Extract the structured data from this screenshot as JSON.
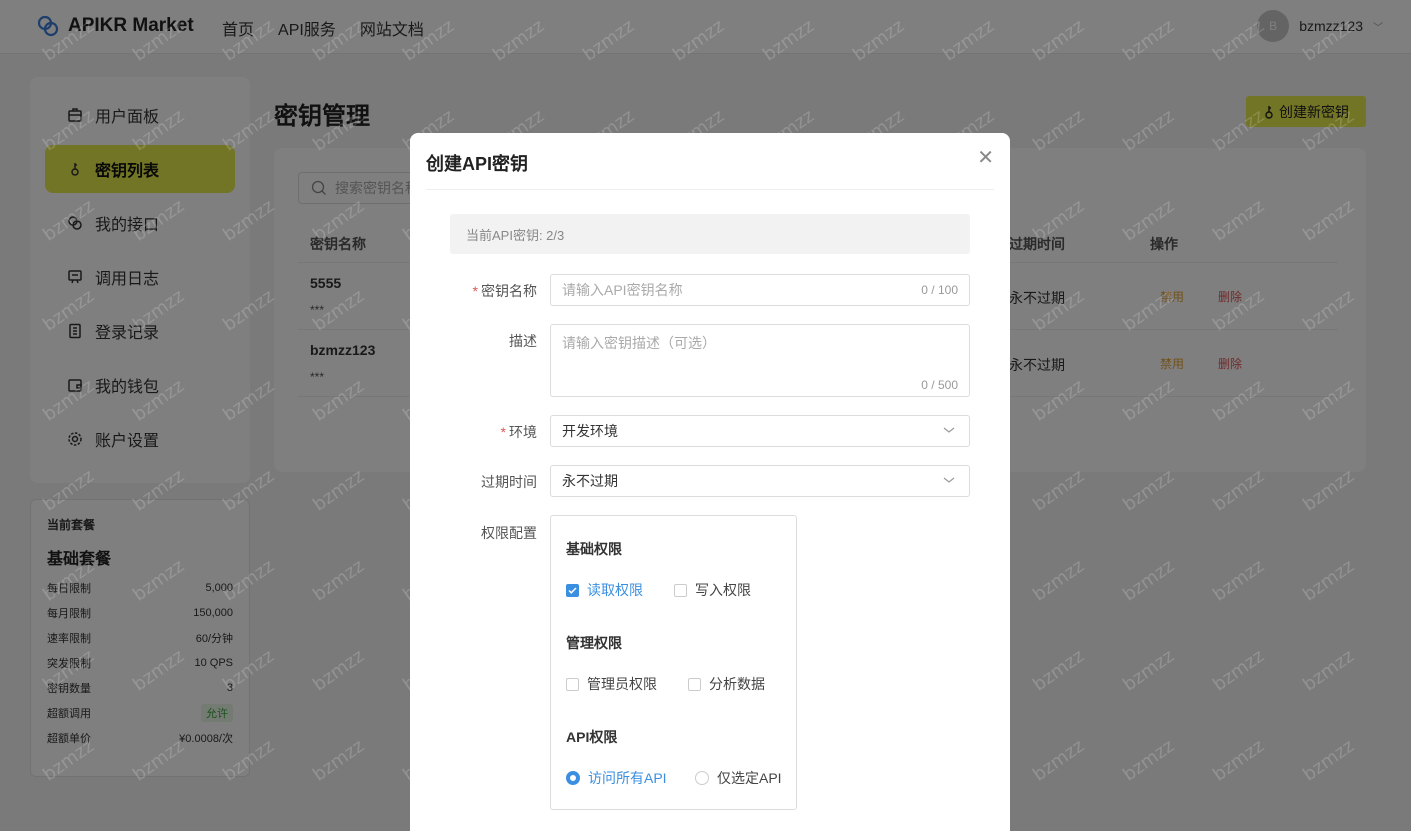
{
  "header": {
    "brand": "APIKR Market",
    "nav": [
      "首页",
      "API服务",
      "网站文档"
    ],
    "user": {
      "avatar_letter": "B",
      "name": "bzmzz123"
    }
  },
  "sidebar": {
    "items": [
      {
        "label": "用户面板",
        "icon": "dashboard-icon"
      },
      {
        "label": "密钥列表",
        "icon": "key-icon",
        "active": true
      },
      {
        "label": "我的接口",
        "icon": "link-icon"
      },
      {
        "label": "调用日志",
        "icon": "log-icon"
      },
      {
        "label": "登录记录",
        "icon": "record-icon"
      },
      {
        "label": "我的钱包",
        "icon": "wallet-icon"
      },
      {
        "label": "账户设置",
        "icon": "gear-icon"
      }
    ]
  },
  "plan": {
    "label": "当前套餐",
    "name": "基础套餐",
    "rows": [
      {
        "k": "每日限制",
        "v": "5,000"
      },
      {
        "k": "每月限制",
        "v": "150,000"
      },
      {
        "k": "速率限制",
        "v": "60/分钟"
      },
      {
        "k": "突发限制",
        "v": "10 QPS"
      },
      {
        "k": "密钥数量",
        "v": "3"
      },
      {
        "k": "超额调用",
        "v": "允许",
        "badge": true
      },
      {
        "k": "超额单价",
        "v": "¥0.0008/次"
      }
    ]
  },
  "main": {
    "title": "密钥管理",
    "create_button": "创建新密钥",
    "search_placeholder": "搜索密钥名称",
    "columns": {
      "name": "密钥名称",
      "expire": "过期时间",
      "ops": "操作"
    },
    "rows": [
      {
        "name": "5555",
        "mask": "***",
        "expire": "永不过期",
        "disable": "禁用",
        "delete": "删除"
      },
      {
        "name": "bzmzz123",
        "mask": "***",
        "expire": "永不过期",
        "disable": "禁用",
        "delete": "删除"
      }
    ]
  },
  "modal": {
    "title": "创建API密钥",
    "info": "当前API密钥: 2/3",
    "fields": {
      "name": {
        "label": "密钥名称",
        "placeholder": "请输入API密钥名称",
        "counter": "0 / 100"
      },
      "desc": {
        "label": "描述",
        "placeholder": "请输入密钥描述（可选）",
        "counter": "0 / 500"
      },
      "env": {
        "label": "环境",
        "value": "开发环境"
      },
      "expire": {
        "label": "过期时间",
        "value": "永不过期"
      },
      "perm": {
        "label": "权限配置"
      }
    },
    "perm": {
      "basic_title": "基础权限",
      "read": "读取权限",
      "write": "写入权限",
      "manage_title": "管理权限",
      "admin": "管理员权限",
      "analytics": "分析数据",
      "api_title": "API权限",
      "all_api": "访问所有API",
      "selected_api": "仅选定API"
    },
    "state": {
      "read": true,
      "write": false,
      "admin": false,
      "analytics": false,
      "api_scope": "all"
    }
  },
  "watermark": "bzmzz",
  "colors": {
    "accent": "#e4ea4a",
    "link": "#3b8fe0",
    "warn": "#e2a23b",
    "danger": "#e05656"
  }
}
